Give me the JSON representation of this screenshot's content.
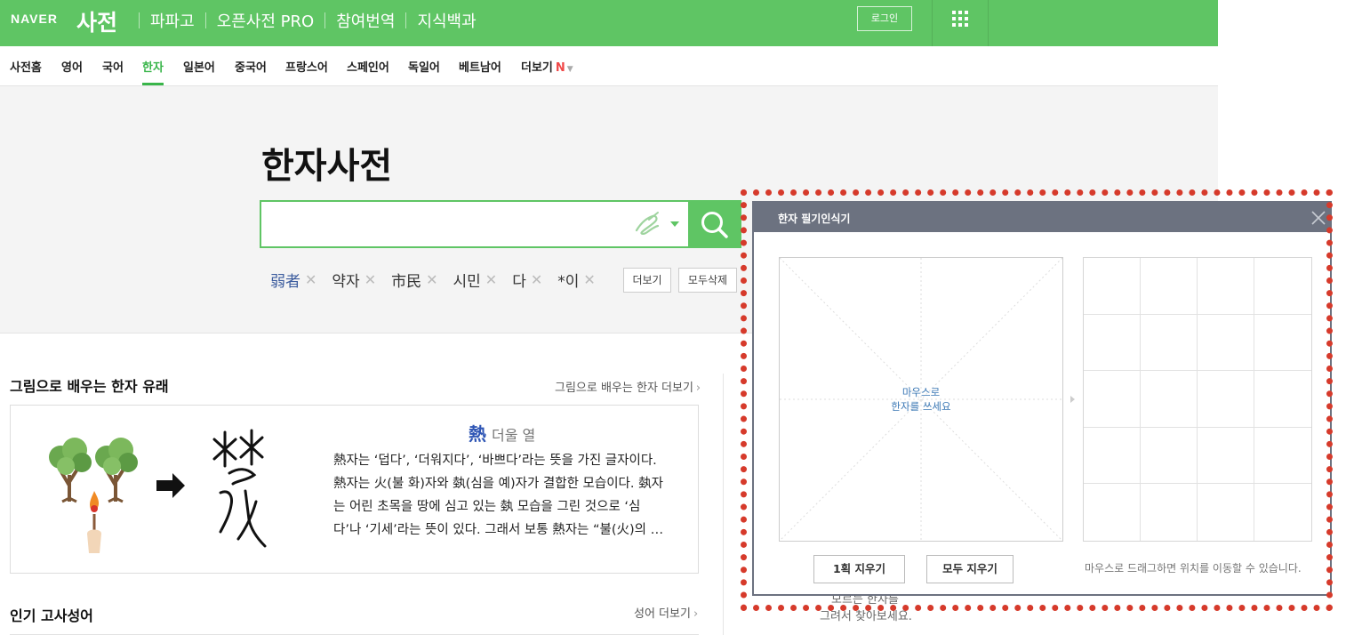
{
  "brand": {
    "logo": "NAVER",
    "dict": "사전",
    "green": "#5fc564"
  },
  "header": {
    "links": [
      "파파고",
      "오픈사전 PRO",
      "참여번역",
      "지식백과"
    ],
    "login": "로그인",
    "apps_icon": "grid-icon"
  },
  "lang_tabs": {
    "items": [
      "사전홈",
      "영어",
      "국어",
      "한자",
      "일본어",
      "중국어",
      "프랑스어",
      "스페인어",
      "독일어",
      "베트남어",
      "더보기"
    ],
    "active": "한자",
    "new_badge": "N"
  },
  "search": {
    "title": "한자사전",
    "value": "",
    "placeholder": "",
    "recent": [
      "弱者",
      "약자",
      "市民",
      "시민",
      "다",
      "*이"
    ],
    "more_btn": "더보기",
    "delete_all_btn": "모두삭제"
  },
  "origin": {
    "title": "그림으로 배우는 한자 유래",
    "more": "그림으로 배우는 한자 더보기",
    "char": "熱",
    "meaning": "더울 열",
    "lines": [
      "熱자는 ‘덥다’, ‘더워지다’, ‘바쁘다’라는 뜻을 가진 글자이다.",
      "熱자는 火(불 화)자와 埶(심을 예)자가 결합한 모습이다. 埶자",
      "는 어린 초목을 땅에 심고 있는 埶 모습을 그린 것으로 ‘심",
      "다’나 ‘기세’라는 뜻이 있다. 그래서 보통 熱자는 “불(火)의 …"
    ]
  },
  "idioms": {
    "title": "인기 고사성어",
    "more": "성어 더보기"
  },
  "peek": {
    "line1": "모르는 한자를",
    "line2": "그려서 찾아보세요."
  },
  "handwriting": {
    "title": "한자 필기인식기",
    "hint_line1": "마우스로",
    "hint_line2": "한자를 쓰세요",
    "erase_one": "1획 지우기",
    "erase_all": "모두 지우기",
    "drag_hint": "마우스로 드래그하면 위치를 이동할 수 있습니다.",
    "highlight_color": "#d63a2b"
  }
}
